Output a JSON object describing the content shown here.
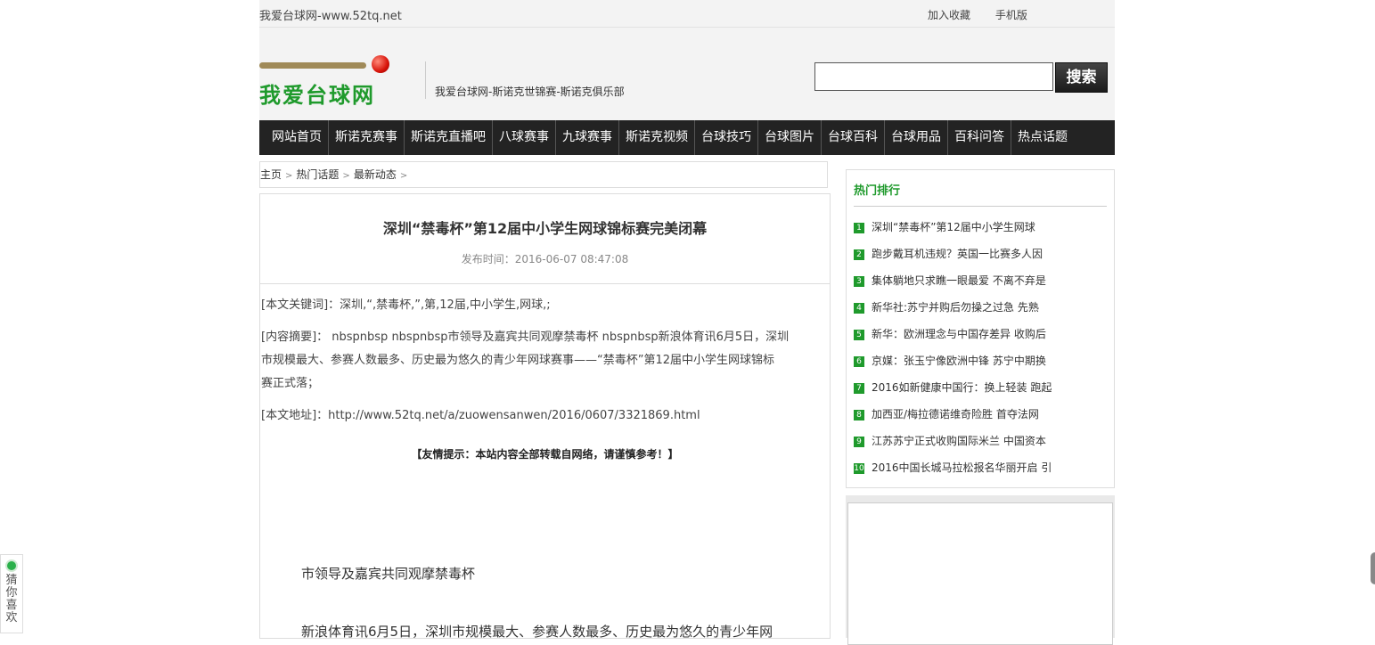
{
  "topbar": {
    "site_name": "我爱台球网-www.52tq.net",
    "bookmark": "加入收藏",
    "mobile": "手机版"
  },
  "header": {
    "logo_text": "我爱台球网",
    "slogan": "我爱台球网-斯诺克世锦赛-斯诺克俱乐部",
    "search_placeholder": "",
    "search_button": "搜索"
  },
  "nav": {
    "items": [
      "网站首页",
      "斯诺克赛事",
      "斯诺克直播吧",
      "八球赛事",
      "九球赛事",
      "斯诺克视频",
      "台球技巧",
      "台球图片",
      "台球百科",
      "台球用品",
      "百科问答",
      "热点话题"
    ]
  },
  "breadcrumb": {
    "items": [
      "主页",
      "热门话题",
      "最新动态"
    ],
    "sep": ">"
  },
  "article": {
    "title": "深圳“禁毒杯”第12届中小学生网球锦标赛完美闭幕",
    "time": "发布时间：2016-06-07 08:47:08",
    "keywords": "[本文关键词]：深圳,“,禁毒杯,”,第,12届,中小学生,网球,;",
    "summary_line1": "[内容摘要]： nbspnbsp nbspnbsp市领导及嘉宾共同观摩禁毒杯 nbspnbsp新浪体育讯6月5日，深圳",
    "summary_line2": "市规模最大、参赛人数最多、历史最为悠久的青少年网球赛事——“禁毒杯”第12届中小学生网球锦标",
    "summary_line3": "赛正式落；",
    "url": "[本文地址]：http://www.52tq.net/a/zuowensanwen/2016/0607/3321869.html",
    "tip": "【友情提示：本站内容全部转载自网络，请谨慎参考！】",
    "caption": "市领导及嘉宾共同观摩禁毒杯",
    "para": "新浪体育讯6月5日，深圳市规模最大、参赛人数最多、历史最为悠久的青少年网"
  },
  "sidebar": {
    "title": "热门排行",
    "items": [
      {
        "num": "1",
        "text": "深圳“禁毒杯”第12届中小学生网球"
      },
      {
        "num": "2",
        "text": "跑步戴耳机违规？英国一比赛多人因"
      },
      {
        "num": "3",
        "text": "集体躺地只求瞧一眼最爱 不离不弃是"
      },
      {
        "num": "4",
        "text": "新华社:苏宁并购后勿操之过急 先熟"
      },
      {
        "num": "5",
        "text": "新华：欧洲理念与中国存差异 收购后"
      },
      {
        "num": "6",
        "text": "京媒：张玉宁像欧洲中锋 苏宁中期换"
      },
      {
        "num": "7",
        "text": "2016如新健康中国行：换上轻装 跑起"
      },
      {
        "num": "8",
        "text": "加西亚/梅拉德诺维奇险胜 首夺法网"
      },
      {
        "num": "9",
        "text": "江苏苏宁正式收购国际米兰 中国资本"
      },
      {
        "num": "10",
        "text": "2016中国长城马拉松报名华丽开启 引"
      }
    ]
  },
  "guess": {
    "label": "猜你喜欢"
  }
}
